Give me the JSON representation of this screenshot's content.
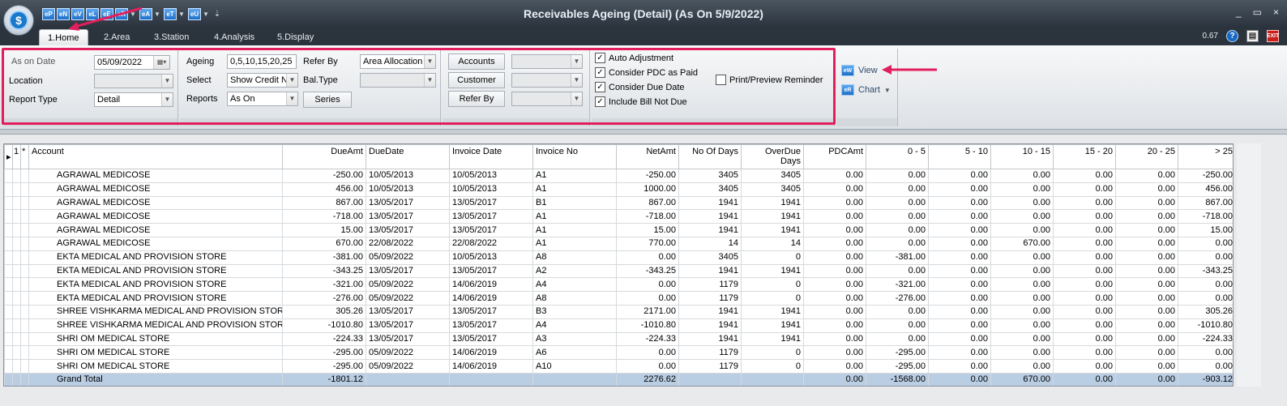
{
  "window": {
    "title": "Receivables Ageing (Detail) (As On 5/9/2022)",
    "version": "0.67",
    "controls": [
      "_",
      "▭",
      "×"
    ]
  },
  "qat": {
    "buttons": [
      "eP",
      "eN",
      "eV",
      "eL",
      "eE",
      "eR",
      "eA",
      "eT",
      "eU"
    ]
  },
  "tabs": [
    "1.Home",
    "2.Area",
    "3.Station",
    "4.Analysis",
    "5.Display"
  ],
  "filters": {
    "as_on_date_label": "As on Date",
    "as_on_date_value": "05/09/2022",
    "location_label": "Location",
    "location_value": "",
    "report_type_label": "Report Type",
    "report_type_value": "Detail",
    "ageing_label": "Ageing",
    "ageing_value": "0,5,10,15,20,25",
    "select_label": "Select",
    "select_value": "Show Credit No",
    "reports_label": "Reports",
    "reports_value": "As On",
    "refer_by_label": "Refer By",
    "refer_by_value": "Area Allocation",
    "bal_type_label": "Bal.Type",
    "bal_type_value": "",
    "series_label": "Series",
    "accounts_label": "Accounts",
    "customer_label": "Customer",
    "refer_by_button_label": "Refer By"
  },
  "options": {
    "auto_adjustment": "Auto Adjustment",
    "consider_pdc": "Consider PDC as Paid",
    "consider_due_date": "Consider Due Date",
    "include_bill_not_due": "Include Bill Not Due",
    "print_preview_reminder": "Print/Preview Reminder"
  },
  "actions": {
    "view": "View",
    "chart": "Chart"
  },
  "grid": {
    "corner": [
      "1",
      "*"
    ],
    "columns": [
      "Account",
      "DueAmt",
      "DueDate",
      "Invoice Date",
      "Invoice No",
      "NetAmt",
      "No Of Days",
      "OverDue Days",
      "PDCAmt",
      "0 - 5",
      "5 - 10",
      "10 - 15",
      "15 - 20",
      "20 - 25",
      "> 25"
    ],
    "rows": [
      [
        "AGRAWAL MEDICOSE",
        "-250.00",
        "10/05/2013",
        "10/05/2013",
        "A1",
        "-250.00",
        "3405",
        "3405",
        "0.00",
        "0.00",
        "0.00",
        "0.00",
        "0.00",
        "0.00",
        "-250.00"
      ],
      [
        "AGRAWAL MEDICOSE",
        "456.00",
        "10/05/2013",
        "10/05/2013",
        "A1",
        "1000.00",
        "3405",
        "3405",
        "0.00",
        "0.00",
        "0.00",
        "0.00",
        "0.00",
        "0.00",
        "456.00"
      ],
      [
        "AGRAWAL MEDICOSE",
        "867.00",
        "13/05/2017",
        "13/05/2017",
        "B1",
        "867.00",
        "1941",
        "1941",
        "0.00",
        "0.00",
        "0.00",
        "0.00",
        "0.00",
        "0.00",
        "867.00"
      ],
      [
        "AGRAWAL MEDICOSE",
        "-718.00",
        "13/05/2017",
        "13/05/2017",
        "A1",
        "-718.00",
        "1941",
        "1941",
        "0.00",
        "0.00",
        "0.00",
        "0.00",
        "0.00",
        "0.00",
        "-718.00"
      ],
      [
        "AGRAWAL MEDICOSE",
        "15.00",
        "13/05/2017",
        "13/05/2017",
        "A1",
        "15.00",
        "1941",
        "1941",
        "0.00",
        "0.00",
        "0.00",
        "0.00",
        "0.00",
        "0.00",
        "15.00"
      ],
      [
        "AGRAWAL MEDICOSE",
        "670.00",
        "22/08/2022",
        "22/08/2022",
        "A1",
        "770.00",
        "14",
        "14",
        "0.00",
        "0.00",
        "0.00",
        "670.00",
        "0.00",
        "0.00",
        "0.00"
      ],
      [
        "EKTA MEDICAL AND PROVISION STORE",
        "-381.00",
        "05/09/2022",
        "10/05/2013",
        "A8",
        "0.00",
        "3405",
        "0",
        "0.00",
        "-381.00",
        "0.00",
        "0.00",
        "0.00",
        "0.00",
        "0.00"
      ],
      [
        "EKTA MEDICAL AND PROVISION STORE",
        "-343.25",
        "13/05/2017",
        "13/05/2017",
        "A2",
        "-343.25",
        "1941",
        "1941",
        "0.00",
        "0.00",
        "0.00",
        "0.00",
        "0.00",
        "0.00",
        "-343.25"
      ],
      [
        "EKTA MEDICAL AND PROVISION STORE",
        "-321.00",
        "05/09/2022",
        "14/06/2019",
        "A4",
        "0.00",
        "1179",
        "0",
        "0.00",
        "-321.00",
        "0.00",
        "0.00",
        "0.00",
        "0.00",
        "0.00"
      ],
      [
        "EKTA MEDICAL AND PROVISION STORE",
        "-276.00",
        "05/09/2022",
        "14/06/2019",
        "A8",
        "0.00",
        "1179",
        "0",
        "0.00",
        "-276.00",
        "0.00",
        "0.00",
        "0.00",
        "0.00",
        "0.00"
      ],
      [
        "SHREE VISHKARMA MEDICAL AND PROVISION STORE",
        "305.26",
        "13/05/2017",
        "13/05/2017",
        "B3",
        "2171.00",
        "1941",
        "1941",
        "0.00",
        "0.00",
        "0.00",
        "0.00",
        "0.00",
        "0.00",
        "305.26"
      ],
      [
        "SHREE VISHKARMA MEDICAL AND PROVISION STORE",
        "-1010.80",
        "13/05/2017",
        "13/05/2017",
        "A4",
        "-1010.80",
        "1941",
        "1941",
        "0.00",
        "0.00",
        "0.00",
        "0.00",
        "0.00",
        "0.00",
        "-1010.80"
      ],
      [
        "SHRI OM MEDICAL STORE",
        "-224.33",
        "13/05/2017",
        "13/05/2017",
        "A3",
        "-224.33",
        "1941",
        "1941",
        "0.00",
        "0.00",
        "0.00",
        "0.00",
        "0.00",
        "0.00",
        "-224.33"
      ],
      [
        "SHRI OM MEDICAL STORE",
        "-295.00",
        "05/09/2022",
        "14/06/2019",
        "A6",
        "0.00",
        "1179",
        "0",
        "0.00",
        "-295.00",
        "0.00",
        "0.00",
        "0.00",
        "0.00",
        "0.00"
      ],
      [
        "SHRI OM MEDICAL STORE",
        "-295.00",
        "05/09/2022",
        "14/06/2019",
        "A10",
        "0.00",
        "1179",
        "0",
        "0.00",
        "-295.00",
        "0.00",
        "0.00",
        "0.00",
        "0.00",
        "0.00"
      ]
    ],
    "total": [
      "Grand Total",
      "-1801.12",
      "",
      "",
      "",
      "2276.62",
      "",
      "",
      "0.00",
      "-1568.00",
      "0.00",
      "670.00",
      "0.00",
      "0.00",
      "-903.12"
    ]
  }
}
